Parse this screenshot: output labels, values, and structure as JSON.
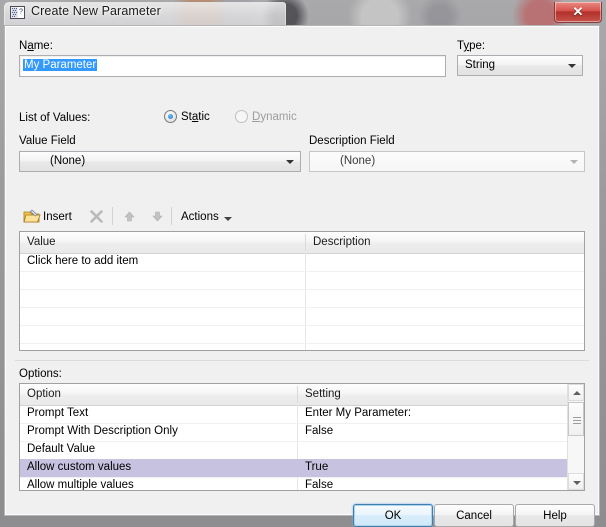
{
  "window": {
    "title": "Create New Parameter",
    "icon": "parameter-window-icon",
    "close_label": "✕"
  },
  "form": {
    "name_label": "Name:",
    "name_value": "My Parameter",
    "type_label": "Type:",
    "type_value": "String",
    "list_of_values_label": "List of Values:",
    "static_label": "Static",
    "dynamic_label": "Dynamic",
    "static_selected": true,
    "dynamic_enabled": false,
    "value_field_label": "Value Field",
    "value_field_value": "(None)",
    "description_field_label": "Description Field",
    "description_field_value": "(None)"
  },
  "toolbar": {
    "insert_label": "Insert",
    "insert_icon": "open-folder-icon",
    "delete_icon": "delete-x-icon",
    "move_up_icon": "arrow-up-icon",
    "move_down_icon": "arrow-down-icon",
    "actions_label": "Actions",
    "actions_icon": "chevron-down-icon"
  },
  "values_grid": {
    "columns": [
      "Value",
      "Description"
    ],
    "rows": [
      {
        "value": "Click here to add item",
        "description": ""
      },
      {
        "value": "",
        "description": ""
      },
      {
        "value": "",
        "description": ""
      },
      {
        "value": "",
        "description": ""
      },
      {
        "value": "",
        "description": ""
      },
      {
        "value": "",
        "description": ""
      }
    ]
  },
  "options": {
    "label": "Options:",
    "columns": [
      "Option",
      "Setting"
    ],
    "rows": [
      {
        "option": "Prompt Text",
        "setting": "Enter My Parameter:",
        "selected": false
      },
      {
        "option": "Prompt With Description Only",
        "setting": "False",
        "selected": false
      },
      {
        "option": "Default Value",
        "setting": "",
        "selected": false
      },
      {
        "option": "Allow custom values",
        "setting": "True",
        "selected": true
      },
      {
        "option": "Allow multiple values",
        "setting": "False",
        "selected": false
      }
    ],
    "scrollbar": {
      "up_icon": "scroll-up-icon",
      "down_icon": "scroll-down-icon"
    }
  },
  "buttons": {
    "ok": "OK",
    "cancel": "Cancel",
    "help": "Help"
  },
  "colors": {
    "selection_blue": "#3399ff",
    "row_highlight": "#c7c2e0",
    "dialog_bg": "#f0f0f0",
    "close_red": "#c6534c"
  }
}
